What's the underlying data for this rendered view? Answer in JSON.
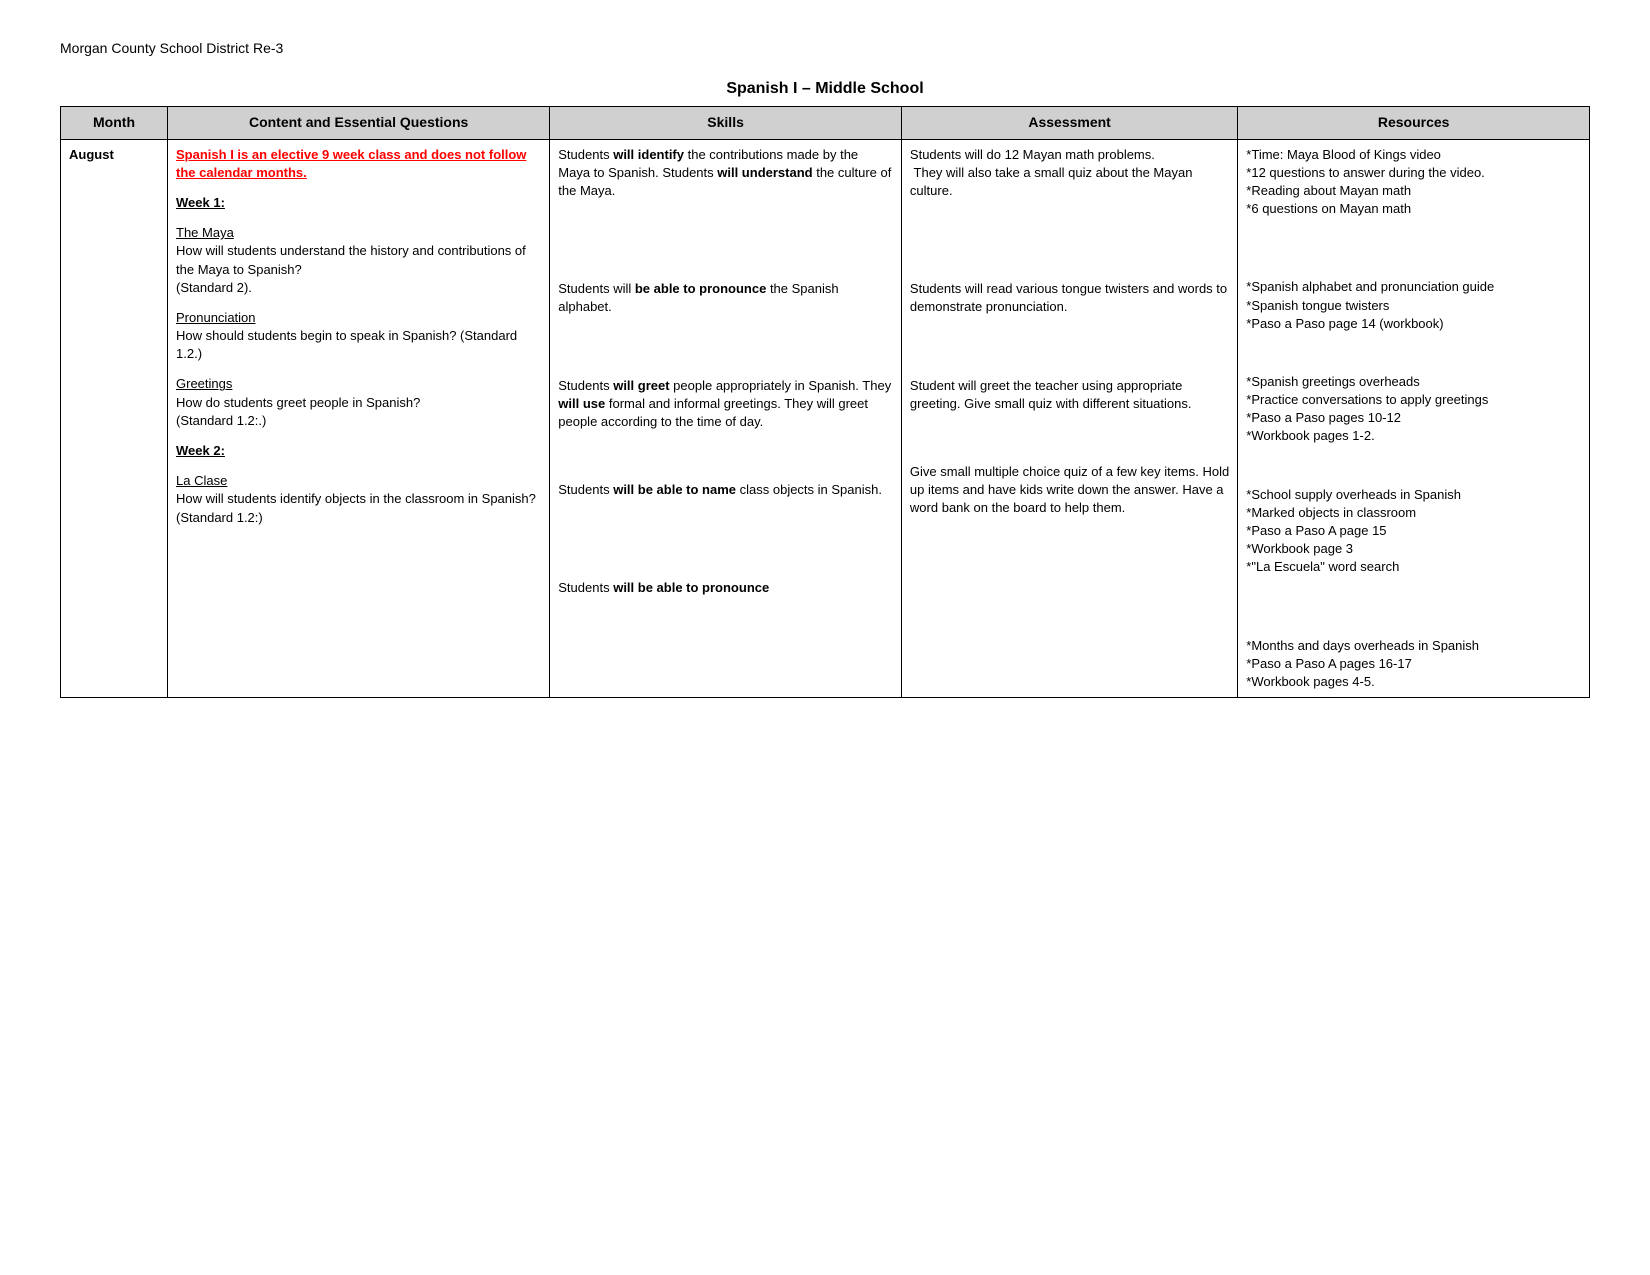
{
  "district": "Morgan County School District Re-3",
  "course_title": "Spanish I – Middle School",
  "headers": {
    "month": "Month",
    "content": "Content and Essential Questions",
    "skills": "Skills",
    "assessment": "Assessment",
    "resources": "Resources"
  },
  "rows": [
    {
      "month": "August",
      "content_sections": [
        {
          "type": "red_underline",
          "text": "Spanish I is an elective 9 week class and does not follow the calendar months."
        },
        {
          "type": "week_heading",
          "text": "Week 1:"
        },
        {
          "type": "topic",
          "title": "The Maya",
          "body": "How will students understand the history and contributions of the Maya to Spanish?\n(Standard 2)."
        },
        {
          "type": "topic",
          "title": "Pronunciation",
          "body": "How should students begin to speak in Spanish? (Standard 1.2.)"
        },
        {
          "type": "topic",
          "title": "Greetings",
          "body": "How do students greet people in Spanish?\n(Standard 1.2:.)"
        },
        {
          "type": "week_heading",
          "text": "Week 2:"
        },
        {
          "type": "topic",
          "title": "La Clase",
          "body": "How will students identify objects in the classroom in Spanish? (Standard 1.2:)"
        }
      ],
      "skills_sections": [
        {
          "text": "Students will identify the contributions made by the Maya to Spanish. Students will understand the culture of the Maya."
        },
        {
          "text": "Students will be able to pronounce the Spanish alphabet."
        },
        {
          "text": "Students will greet people appropriately in Spanish. They will use formal and informal greetings. They will greet people according to the time of day."
        },
        {
          "text": "Students will be able to name class objects in Spanish."
        },
        {
          "text": "Students will be able to pronounce"
        }
      ],
      "assessment_sections": [
        {
          "text": "Students will do 12 Mayan math problems.\n They will also take a small quiz about the Mayan culture."
        },
        {
          "text": "Students will read various tongue twisters and words to demonstrate pronunciation."
        },
        {
          "text": "Student will greet the teacher using appropriate greeting. Give small quiz with different situations."
        },
        {
          "text": "Give small multiple choice quiz of a few key items. Hold up items and have kids write down the answer. Have a word bank on the board to help them."
        }
      ],
      "resources_sections": [
        {
          "text": "*Time: Maya Blood of Kings video\n*12 questions to answer during the video.\n*Reading about Mayan math\n*6 questions on Mayan math"
        },
        {
          "text": "*Spanish alphabet and pronunciation guide\n*Spanish tongue twisters\n*Paso a Paso page 14 (workbook)"
        },
        {
          "text": "*Spanish greetings overheads\n*Practice conversations to apply greetings\n*Paso a Paso pages 10-12\n*Workbook pages 1-2."
        },
        {
          "text": "*School supply overheads in Spanish\n*Marked objects in classroom\n*Paso a Paso A page 15\n*Workbook page 3\n*\"La Escuela\" word search"
        },
        {
          "text": "*Months and days overheads in Spanish\n*Paso a Paso A pages 16-17\n*Workbook pages 4-5."
        }
      ]
    }
  ]
}
